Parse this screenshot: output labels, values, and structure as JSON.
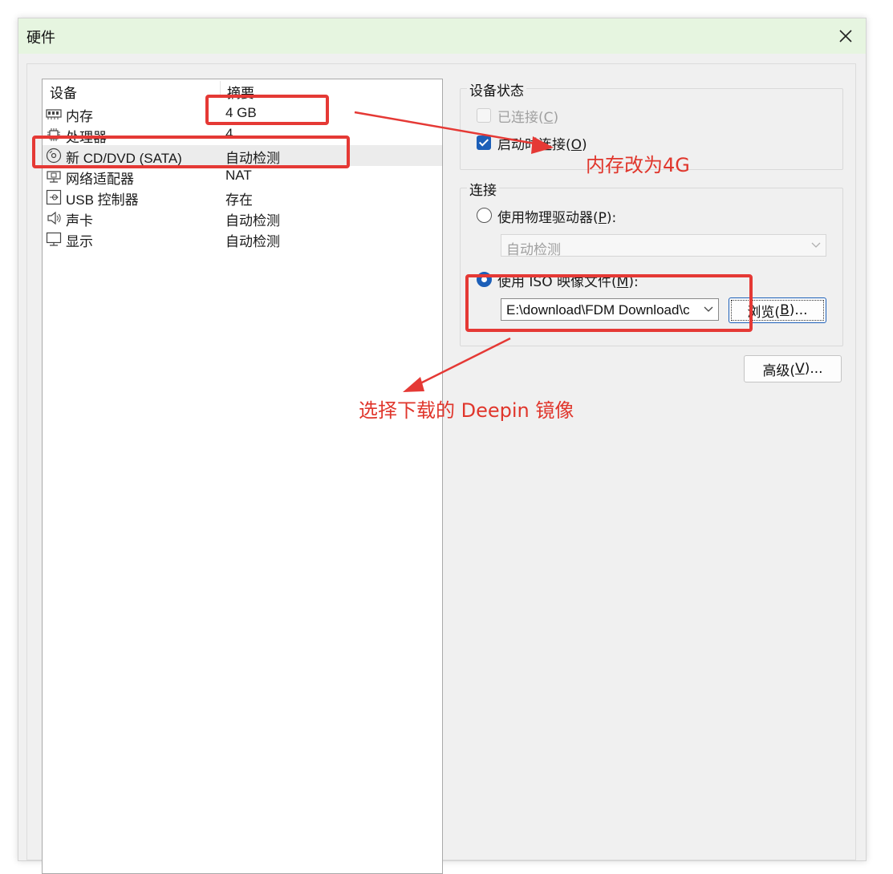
{
  "window": {
    "title": "硬件"
  },
  "device_list": {
    "headers": {
      "device": "设备",
      "summary": "摘要"
    },
    "rows": [
      {
        "name": "内存",
        "summary": "4 GB",
        "icon": "memory-icon"
      },
      {
        "name": "处理器",
        "summary": "4",
        "icon": "processor-icon"
      },
      {
        "name": "新 CD/DVD (SATA)",
        "summary": "自动检测",
        "icon": "cd-dvd-icon"
      },
      {
        "name": "网络适配器",
        "summary": "NAT",
        "icon": "network-adapter-icon"
      },
      {
        "name": "USB 控制器",
        "summary": "存在",
        "icon": "usb-icon"
      },
      {
        "name": "声卡",
        "summary": "自动检测",
        "icon": "speaker-icon"
      },
      {
        "name": "显示",
        "summary": "自动检测",
        "icon": "monitor-icon"
      }
    ]
  },
  "device_status": {
    "label": "设备状态",
    "connected": {
      "text": "已连接(",
      "key": "C",
      "suffix": ")",
      "checked": false,
      "enabled": false
    },
    "connect_on_power": {
      "text": "启动时连接(",
      "key": "O",
      "suffix": ")",
      "checked": true
    }
  },
  "connection": {
    "label": "连接",
    "physical": {
      "text": "使用物理驱动器(",
      "key": "P",
      "suffix": "):",
      "selected": false
    },
    "physical_combo_value": "自动检测",
    "iso": {
      "text": "使用 ISO 映像文件(",
      "key": "M",
      "suffix": "):",
      "selected": true
    },
    "iso_path": "E:\\download\\FDM Download\\c",
    "browse": {
      "text": "浏览(",
      "key": "B",
      "suffix": ")..."
    }
  },
  "advanced": {
    "text": "高级(",
    "key": "V",
    "suffix": ")..."
  },
  "annotations": {
    "memory_note": "内存改为4G",
    "iso_note": "选择下载的 Deepin 镜像",
    "color": "#e53935"
  }
}
